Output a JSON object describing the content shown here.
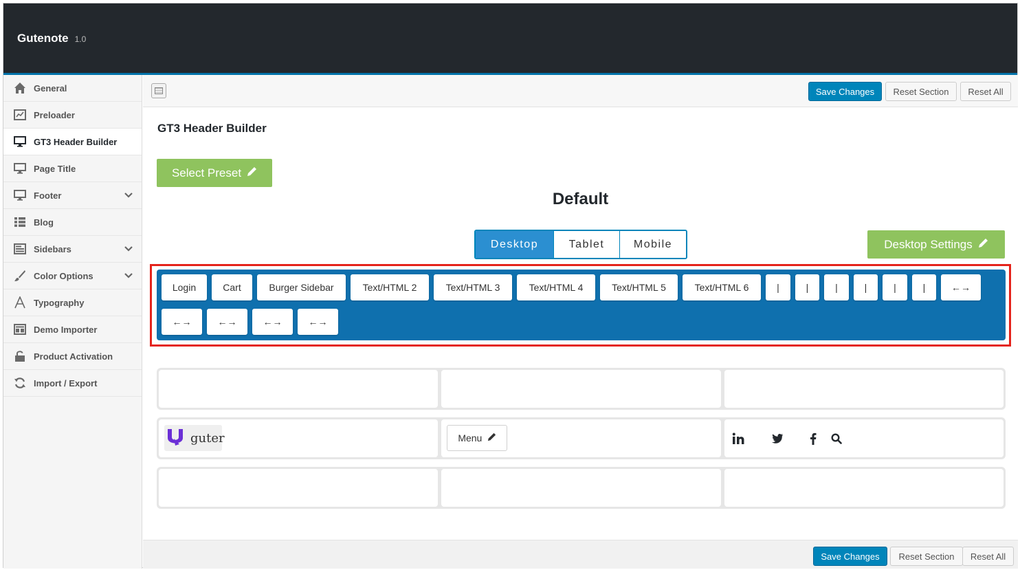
{
  "app": {
    "title": "Gutenote",
    "version": "1.0"
  },
  "sidebar": {
    "items": [
      {
        "label": "General",
        "icon": "home-icon",
        "active": false,
        "has_submenu": false
      },
      {
        "label": "Preloader",
        "icon": "chart-icon",
        "active": false,
        "has_submenu": false
      },
      {
        "label": "GT3 Header Builder",
        "icon": "monitor-icon",
        "active": true,
        "has_submenu": false
      },
      {
        "label": "Page Title",
        "icon": "monitor-icon",
        "active": false,
        "has_submenu": false
      },
      {
        "label": "Footer",
        "icon": "monitor-icon",
        "active": false,
        "has_submenu": true
      },
      {
        "label": "Blog",
        "icon": "list-icon",
        "active": false,
        "has_submenu": false
      },
      {
        "label": "Sidebars",
        "icon": "layout-icon",
        "active": false,
        "has_submenu": true
      },
      {
        "label": "Color Options",
        "icon": "brush-icon",
        "active": false,
        "has_submenu": true
      },
      {
        "label": "Typography",
        "icon": "typography-icon",
        "active": false,
        "has_submenu": false
      },
      {
        "label": "Demo Importer",
        "icon": "layout-icon",
        "active": false,
        "has_submenu": false
      },
      {
        "label": "Product Activation",
        "icon": "lock-icon",
        "active": false,
        "has_submenu": false
      },
      {
        "label": "Import / Export",
        "icon": "refresh-icon",
        "active": false,
        "has_submenu": false
      }
    ]
  },
  "toolbar": {
    "save": "Save Changes",
    "reset_section": "Reset Section",
    "reset_all": "Reset All"
  },
  "builder": {
    "title": "GT3 Header Builder",
    "select_preset": "Select Preset",
    "preset_name": "Default",
    "devices": [
      "Desktop",
      "Tablet",
      "Mobile"
    ],
    "active_device": "Desktop",
    "device_settings": "Desktop Settings",
    "palette": [
      "Login",
      "Cart",
      "Burger Sidebar",
      "Text/HTML 2",
      "Text/HTML 3",
      "Text/HTML 4",
      "Text/HTML 5",
      "Text/HTML 6",
      "|",
      "|",
      "|",
      "|",
      "|",
      "|",
      "←→",
      "←→",
      "←→",
      "←→",
      "←→"
    ],
    "logo_text": "guter",
    "menu_label": "Menu"
  },
  "footer": {
    "save": "Save Changes",
    "reset_section": "Reset Section",
    "reset_all": "Reset All"
  },
  "colors": {
    "accent": "#0085ba",
    "palette_bg": "#0f70ae",
    "green": "#8fc35e",
    "highlight": "#e4231b",
    "topbar": "#23282d"
  }
}
